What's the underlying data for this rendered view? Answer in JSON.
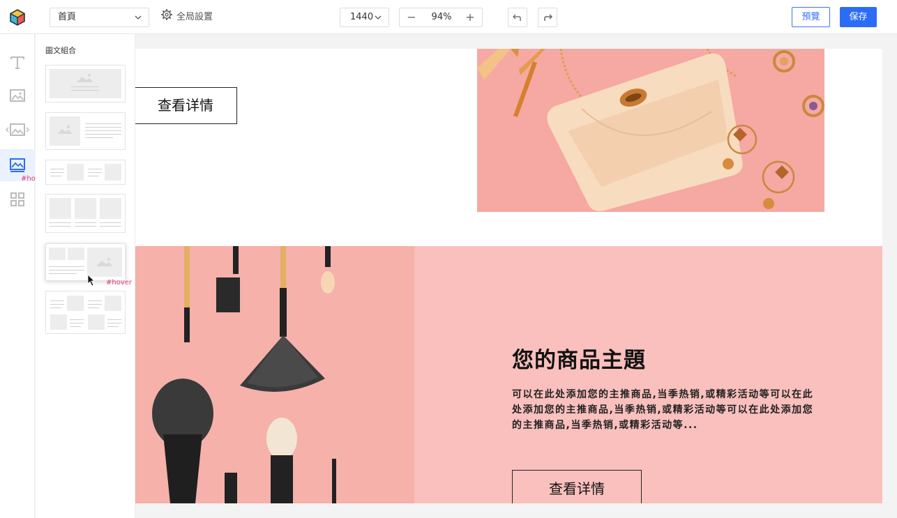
{
  "topbar": {
    "page_select": "首頁",
    "global_settings": "全局設置",
    "width_select": "1440",
    "zoom": {
      "value": "94%",
      "minus": "−",
      "plus": "+"
    },
    "preview_label": "預覽",
    "save_label": "保存",
    "accent": "#2b6cf6"
  },
  "rail": {
    "items": [
      "text-icon",
      "image-icon",
      "carousel-icon",
      "image-text-icon",
      "widgets-icon"
    ],
    "active_index": 3,
    "hover_tag": "#hover"
  },
  "panel": {
    "title": "圖文組合",
    "hover_tag": "#hover",
    "templates": [
      "banner",
      "image-left-text",
      "alternating-row",
      "three-column",
      "grid-with-large-image",
      "alternating-grid"
    ]
  },
  "canvas": {
    "section1": {
      "button_label": "查看详情"
    },
    "section2": {
      "title": "您的商品主題",
      "description": "可以在此处添加您的主推商品,当季热销,或精彩活动等可以在此处添加您的主推商品,当季热销,或精彩活动等可以在此处添加您的主推商品,当季热销,或精彩活动等...",
      "button_label": "查看详情",
      "background": "#f9c0bd"
    }
  }
}
